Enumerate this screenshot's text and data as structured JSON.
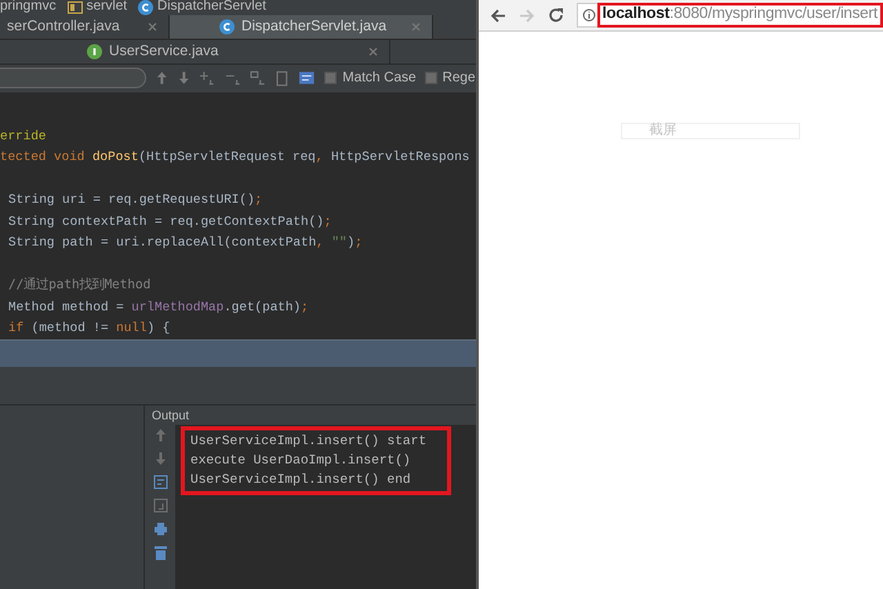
{
  "ide": {
    "breadcrumb": [
      {
        "label": "pringmvc"
      },
      {
        "label": "servlet",
        "kind": "folder"
      },
      {
        "label": "DispatcherServlet",
        "kind": "class"
      }
    ],
    "tab_rows": [
      [
        {
          "label": "serController.java",
          "kind": "none",
          "selected": false
        },
        {
          "label": "DispatcherServlet.java",
          "kind": "class",
          "selected": true
        }
      ],
      [
        {
          "label": "UserService.java",
          "kind": "interface",
          "selected": false
        }
      ]
    ],
    "find_bar": {
      "options": [
        {
          "label": "Match Case",
          "checked": false
        },
        {
          "label": "Rege",
          "checked": false
        }
      ]
    },
    "code_lines": [
      {
        "kind": "header",
        "segments": [
          {
            "kind": "annotation",
            "text": "erride"
          }
        ]
      },
      {
        "kind": "header",
        "segments": [
          {
            "kind": "keyword",
            "text": "tected void "
          },
          {
            "kind": "method",
            "text": "doPost"
          },
          {
            "kind": "plain",
            "text": "(HttpServletRequest req"
          },
          {
            "kind": "keyword",
            "text": ", "
          },
          {
            "kind": "plain",
            "text": "HttpServletRespons"
          }
        ]
      },
      {
        "kind": "blank"
      },
      {
        "kind": "body",
        "segments": [
          {
            "kind": "plain",
            "text": "String uri = req.getRequestURI()"
          },
          {
            "kind": "keyword",
            "text": ";"
          }
        ]
      },
      {
        "kind": "body",
        "segments": [
          {
            "kind": "plain",
            "text": "String contextPath = req.getContextPath()"
          },
          {
            "kind": "keyword",
            "text": ";"
          }
        ]
      },
      {
        "kind": "body",
        "segments": [
          {
            "kind": "plain",
            "text": "String path = uri.replaceAll(contextPath"
          },
          {
            "kind": "keyword",
            "text": ", "
          },
          {
            "kind": "string",
            "text": "\"\""
          },
          {
            "kind": "plain",
            "text": ")"
          },
          {
            "kind": "keyword",
            "text": ";"
          }
        ]
      },
      {
        "kind": "blank"
      },
      {
        "kind": "body",
        "segments": [
          {
            "kind": "comment",
            "text": "//通过path找到Method"
          }
        ]
      },
      {
        "kind": "body",
        "segments": [
          {
            "kind": "plain",
            "text": "Method method = "
          },
          {
            "kind": "field",
            "text": "urlMethodMap"
          },
          {
            "kind": "plain",
            "text": ".get(path)"
          },
          {
            "kind": "keyword",
            "text": ";"
          }
        ]
      },
      {
        "kind": "body",
        "segments": [
          {
            "kind": "keyword",
            "text": "if "
          },
          {
            "kind": "plain",
            "text": "(method != "
          },
          {
            "kind": "keyword",
            "text": "null"
          },
          {
            "kind": "plain",
            "text": ") {"
          }
        ]
      }
    ],
    "output": {
      "title": "Output",
      "lines": [
        "UserServiceImpl.insert() start",
        "execute UserDaoImpl.insert()",
        "UserServiceImpl.insert() end"
      ]
    }
  },
  "browser": {
    "back_enabled": true,
    "forward_enabled": false,
    "address_host": "localhost",
    "address_path": ":8080/myspringmvc/user/insert",
    "page_text": "截屏"
  }
}
